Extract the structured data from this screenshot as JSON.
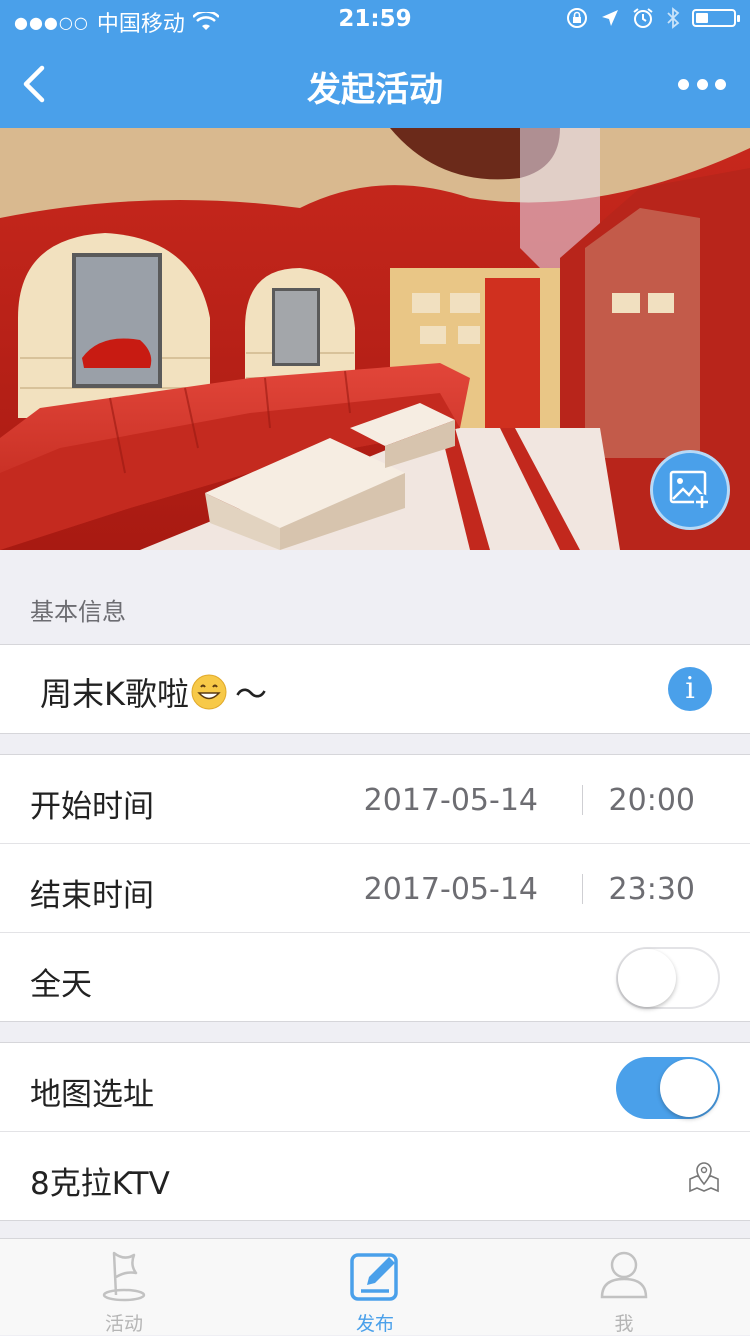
{
  "status_bar": {
    "carrier": "中国移动",
    "time": "21:59"
  },
  "nav": {
    "title": "发起活动"
  },
  "basic_info": {
    "section_label": "基本信息",
    "activity_title": "周末K歌啦",
    "title_suffix": "～"
  },
  "time_group": {
    "start_label": "开始时间",
    "start_date": "2017-05-14",
    "start_time": "20:00",
    "end_label": "结束时间",
    "end_date": "2017-05-14",
    "end_time": "23:30",
    "all_day_label": "全天",
    "all_day_on": false
  },
  "location_group": {
    "map_label": "地图选址",
    "map_on": true,
    "location_name": "8克拉KTV"
  },
  "tab_bar": {
    "tabs": [
      {
        "label": "活动",
        "active": false
      },
      {
        "label": "发布",
        "active": true
      },
      {
        "label": "我",
        "active": false
      }
    ]
  },
  "colors": {
    "accent": "#4aa0ea",
    "background": "#efeff4"
  }
}
